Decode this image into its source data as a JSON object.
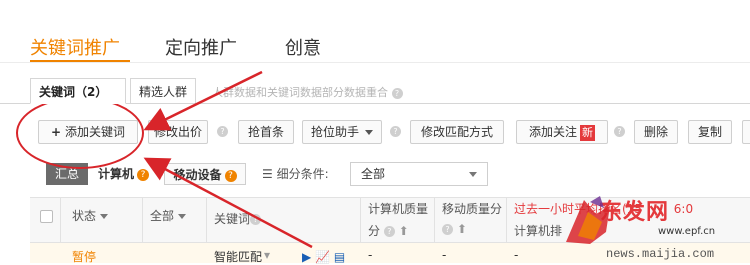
{
  "main_tabs": [
    {
      "label": "关键词推广",
      "active": true
    },
    {
      "label": "定向推广",
      "active": false
    },
    {
      "label": "创意",
      "active": false
    }
  ],
  "sub_tabs": [
    {
      "label": "关键词（2）",
      "active": true
    },
    {
      "label": "精选人群",
      "active": false
    }
  ],
  "sub_hint": "人群数据和关键词数据部分数据重合",
  "toolbar": {
    "add_keyword": "添加关键词",
    "modify_bid": "修改出价",
    "grab_top": "抢首条",
    "rank_helper": "抢位助手",
    "modify_match": "修改匹配方式",
    "add_follow": "添加关注",
    "new_badge": "新",
    "delete": "删除",
    "copy": "复制"
  },
  "filter": {
    "summary": "汇总",
    "computer": "计算机",
    "mobile": "移动设备",
    "segment_label": "细分条件:",
    "segment_value": "全部"
  },
  "table": {
    "headers": {
      "status": "状态",
      "all": "全部",
      "keyword": "关键词",
      "pc_quality_1": "计算机质量",
      "pc_quality_2": "分",
      "mobile_quality_1": "移动质量分",
      "rank_1": "过去一小时平均排名(15",
      "rank_time": "6:0",
      "rank_2": "计算机排"
    },
    "rows": [
      {
        "status": "暂停",
        "match": "智能匹配",
        "pc_quality": "-",
        "mobile_quality": "-",
        "rank": "-"
      }
    ]
  },
  "watermark": {
    "logo_text": "东发网",
    "site": "www.epf.cn",
    "news_url": "news.maijia.com"
  },
  "colors": {
    "accent": "#f08300",
    "annotation_red": "#d8252a",
    "badge_red": "#e4393c",
    "status_orange": "#f08300"
  }
}
